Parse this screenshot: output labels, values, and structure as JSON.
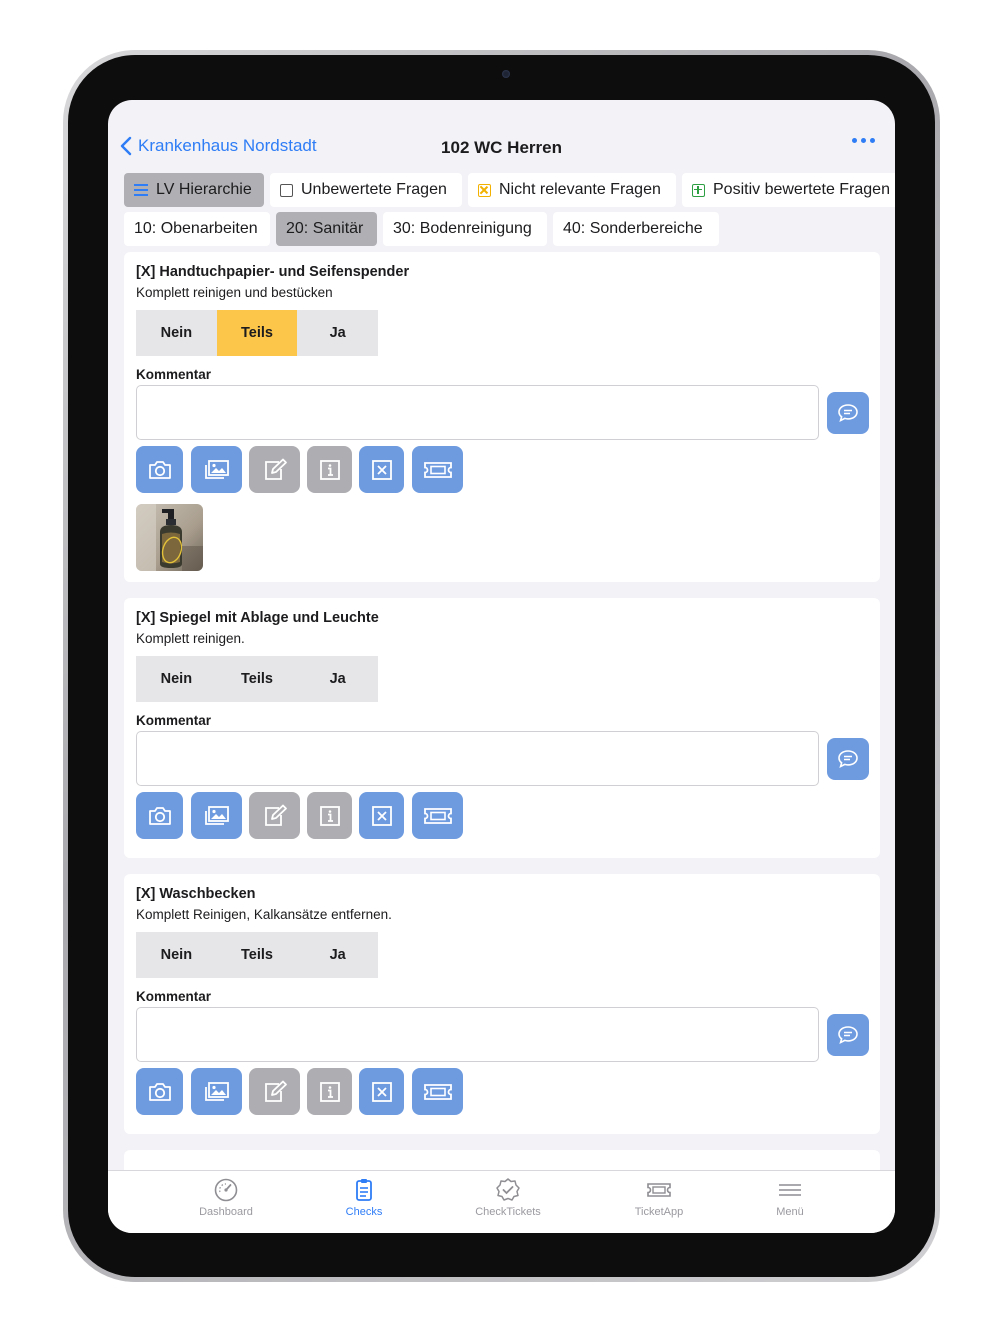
{
  "nav": {
    "back_label": "Krankenhaus Nordstadt",
    "title": "102 WC Herren"
  },
  "filters": {
    "row1": [
      {
        "label": "LV Hierarchie",
        "icon": "list-icon",
        "active": true
      },
      {
        "label": "Unbewertete Fragen",
        "icon": "checkbox-empty-icon",
        "active": false
      },
      {
        "label": "Nicht relevante Fragen",
        "icon": "checkbox-x-icon",
        "active": false
      },
      {
        "label": "Positiv bewertete Fragen",
        "icon": "checkbox-plus-icon",
        "active": false
      }
    ],
    "row2": [
      {
        "label": "10: Obenarbeiten",
        "active": false
      },
      {
        "label": "20: Sanitär",
        "active": true
      },
      {
        "label": "30: Bodenreinigung",
        "active": false
      },
      {
        "label": "40: Sonderbereiche",
        "active": false
      }
    ]
  },
  "rating_options": [
    "Nein",
    "Teils",
    "Ja"
  ],
  "comment_label": "Kommentar",
  "items": [
    {
      "title": "[X] Handtuchpapier- und Seifenspender",
      "description": "Komplett reinigen und bestücken",
      "selected": "Teils",
      "comment": "",
      "has_photo": true
    },
    {
      "title": "[X] Spiegel mit Ablage und Leuchte",
      "description": "Komplett reinigen.",
      "selected": null,
      "comment": "",
      "has_photo": false
    },
    {
      "title": "[X] Waschbecken",
      "description": "Komplett Reinigen, Kalkansätze entfernen.",
      "selected": null,
      "comment": "",
      "has_photo": false
    }
  ],
  "tools": [
    "camera-icon",
    "gallery-icon",
    "edit-icon",
    "info-icon",
    "not-relevant-icon",
    "ticket-icon"
  ],
  "tabbar": [
    {
      "label": "Dashboard",
      "icon": "gauge-icon",
      "active": false
    },
    {
      "label": "Checks",
      "icon": "clipboard-icon",
      "active": true
    },
    {
      "label": "CheckTickets",
      "icon": "badge-check-icon",
      "active": false
    },
    {
      "label": "TicketApp",
      "icon": "ticket-icon",
      "active": false
    },
    {
      "label": "Menü",
      "icon": "menu-icon",
      "active": false
    }
  ],
  "colors": {
    "accent": "#2f7df6",
    "tool_blue": "#6e9be0",
    "tool_grey": "#aeaeb2",
    "selected_yellow": "#fcc64a"
  }
}
